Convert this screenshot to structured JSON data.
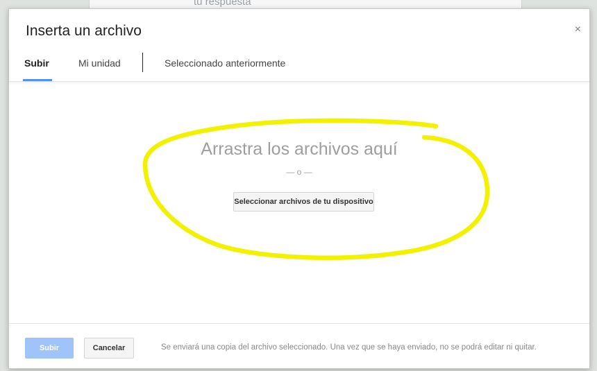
{
  "backdrop": {
    "partial_text": "tu respuesta"
  },
  "dialog": {
    "title": "Inserta un archivo",
    "close_glyph": "×",
    "close_icon": "close-icon"
  },
  "tabs": [
    {
      "label": "Subir",
      "active": true
    },
    {
      "label": "Mi unidad",
      "active": false
    },
    {
      "label": "Seleccionado anteriormente",
      "active": false
    }
  ],
  "dropzone": {
    "title": "Arrastra los archivos aquí",
    "separator": "— o —",
    "select_button": "Seleccionar archivos de tu dispositivo"
  },
  "annotation": {
    "color": "#f2f200"
  },
  "footer": {
    "primary_button": "Subir",
    "secondary_button": "Cancelar",
    "note": "Se enviará una copia del archivo seleccionado. Una vez que se haya enviado, no se podrá editar ni quitar."
  },
  "colors": {
    "accent": "#4d90fe",
    "primary_disabled": "#a0c3fa"
  }
}
